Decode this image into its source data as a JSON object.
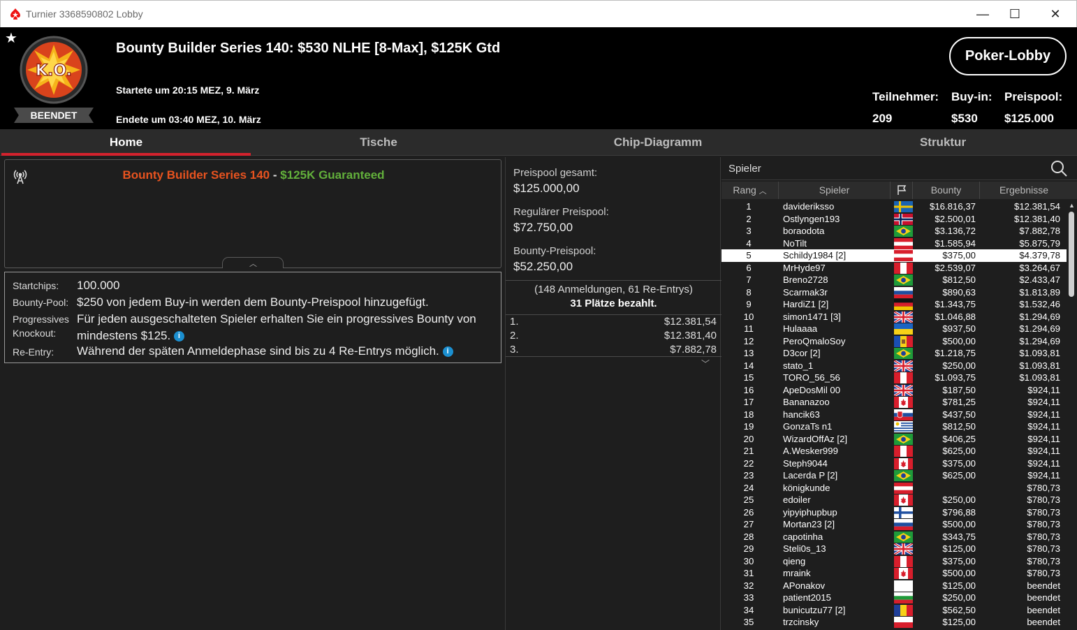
{
  "window": {
    "title": "Turnier 3368590802 Lobby",
    "minimize": "—",
    "maximize": "☐",
    "close": "✕"
  },
  "header": {
    "title": "Bounty Builder Series 140: $530 NLHE [8-Max], $125K Gtd",
    "started": "Startete um 20:15 MEZ, 9. März",
    "ended": "Endete um 03:40 MEZ, 10. März",
    "status_badge": "BEENDET",
    "logo_text": "K.O.",
    "lobby_button": "Poker-Lobby",
    "stats": [
      {
        "label": "Teilnehmer:",
        "value": "209"
      },
      {
        "label": "Buy-in:",
        "value": "$530"
      },
      {
        "label": "Preispool:",
        "value": "$125.000"
      }
    ]
  },
  "tabs": [
    {
      "label": "Home",
      "active": true
    },
    {
      "label": "Tische",
      "active": false
    },
    {
      "label": "Chip-Diagramm",
      "active": false
    },
    {
      "label": "Struktur",
      "active": false
    }
  ],
  "info": {
    "title_orange": "Bounty Builder Series 140",
    "title_sep": " - ",
    "title_green": "$125K Guaranteed"
  },
  "details": {
    "startchips_label": "Startchips:",
    "startchips_value": "100.000",
    "bountypool_label": "Bounty-Pool:",
    "bountypool_value": "$250 von jedem Buy-in werden dem Bounty-Preispool hinzugefügt.",
    "progressive_label_1": "Progressives",
    "progressive_label_2": "Knockout:",
    "progressive_value_1": "Für jeden ausgeschalteten Spieler erhalten Sie ein progressives Bounty von",
    "progressive_value_2": "mindestens $125.",
    "reentry_label": "Re-Entry:",
    "reentry_value": "Während der späten Anmeldephase sind bis zu 4 Re-Entrys möglich."
  },
  "prize": {
    "total_label": "Preispool gesamt:",
    "total_value": "$125.000,00",
    "regular_label": "Regulärer Preispool:",
    "regular_value": "$72.750,00",
    "bounty_label": "Bounty-Preispool:",
    "bounty_value": "$52.250,00",
    "entries_note": "(148 Anmeldungen, 61 Re-Entrys)",
    "paid_note": "31 Plätze bezahlt.",
    "payouts": [
      {
        "place": "1.",
        "amount": "$12.381,54"
      },
      {
        "place": "2.",
        "amount": "$12.381,40"
      },
      {
        "place": "3.",
        "amount": "$7.882,78"
      }
    ]
  },
  "players": {
    "search_label": "Spieler",
    "columns": {
      "rank": "Rang",
      "player": "Spieler",
      "bounty": "Bounty",
      "result": "Ergebnisse"
    },
    "rows": [
      {
        "rank": "1",
        "name": "davideriksso",
        "flag": "se",
        "bounty": "$16.816,37",
        "result": "$12.381,54"
      },
      {
        "rank": "2",
        "name": "Ostlyngen193",
        "flag": "no",
        "bounty": "$2.500,01",
        "result": "$12.381,40"
      },
      {
        "rank": "3",
        "name": "boraodota",
        "flag": "br",
        "bounty": "$3.136,72",
        "result": "$7.882,78"
      },
      {
        "rank": "4",
        "name": "NoTilt",
        "flag": "at",
        "bounty": "$1.585,94",
        "result": "$5.875,79"
      },
      {
        "rank": "5",
        "name": "Schildy1984 [2]",
        "flag": "at",
        "bounty": "$375,00",
        "result": "$4.379,78",
        "selected": true
      },
      {
        "rank": "6",
        "name": "MrHyde97",
        "flag": "pe",
        "bounty": "$2.539,07",
        "result": "$3.264,67"
      },
      {
        "rank": "7",
        "name": "Breno2728",
        "flag": "br",
        "bounty": "$812,50",
        "result": "$2.433,47"
      },
      {
        "rank": "8",
        "name": "Scarmak3r",
        "flag": "si",
        "bounty": "$890,63",
        "result": "$1.813,89"
      },
      {
        "rank": "9",
        "name": "HardiZ1 [2]",
        "flag": "de",
        "bounty": "$1.343,75",
        "result": "$1.532,46"
      },
      {
        "rank": "10",
        "name": "simon1471 [3]",
        "flag": "gb",
        "bounty": "$1.046,88",
        "result": "$1.294,69"
      },
      {
        "rank": "11",
        "name": "Hulaaaa",
        "flag": "ua",
        "bounty": "$937,50",
        "result": "$1.294,69"
      },
      {
        "rank": "12",
        "name": "PeroQmaloSoy",
        "flag": "md",
        "bounty": "$500,00",
        "result": "$1.294,69"
      },
      {
        "rank": "13",
        "name": "D3cor [2]",
        "flag": "br",
        "bounty": "$1.218,75",
        "result": "$1.093,81"
      },
      {
        "rank": "14",
        "name": "stato_1",
        "flag": "gb",
        "bounty": "$250,00",
        "result": "$1.093,81"
      },
      {
        "rank": "15",
        "name": "TORO_56_56",
        "flag": "pe",
        "bounty": "$1.093,75",
        "result": "$1.093,81"
      },
      {
        "rank": "16",
        "name": "ApeDosMil 00",
        "flag": "gb",
        "bounty": "$187,50",
        "result": "$924,11"
      },
      {
        "rank": "17",
        "name": "Bananazoo",
        "flag": "ca",
        "bounty": "$781,25",
        "result": "$924,11"
      },
      {
        "rank": "18",
        "name": "hancik63",
        "flag": "sk",
        "bounty": "$437,50",
        "result": "$924,11"
      },
      {
        "rank": "19",
        "name": "GonzaTs n1",
        "flag": "uy",
        "bounty": "$812,50",
        "result": "$924,11"
      },
      {
        "rank": "20",
        "name": "WizardOffAz [2]",
        "flag": "br",
        "bounty": "$406,25",
        "result": "$924,11"
      },
      {
        "rank": "21",
        "name": "A.Wesker999",
        "flag": "pe",
        "bounty": "$625,00",
        "result": "$924,11"
      },
      {
        "rank": "22",
        "name": "Steph9044",
        "flag": "ca",
        "bounty": "$375,00",
        "result": "$924,11"
      },
      {
        "rank": "23",
        "name": "Lacerda P [2]",
        "flag": "br",
        "bounty": "$625,00",
        "result": "$924,11"
      },
      {
        "rank": "24",
        "name": "königkunde",
        "flag": "at",
        "bounty": "",
        "result": "$780,73"
      },
      {
        "rank": "25",
        "name": "edoiler",
        "flag": "ca",
        "bounty": "$250,00",
        "result": "$780,73"
      },
      {
        "rank": "26",
        "name": "yipyiphupbup",
        "flag": "fi",
        "bounty": "$796,88",
        "result": "$780,73"
      },
      {
        "rank": "27",
        "name": "Mortan23 [2]",
        "flag": "ru",
        "bounty": "$500,00",
        "result": "$780,73"
      },
      {
        "rank": "28",
        "name": "capotinha",
        "flag": "br",
        "bounty": "$343,75",
        "result": "$780,73"
      },
      {
        "rank": "29",
        "name": "Steli0s_13",
        "flag": "gb",
        "bounty": "$125,00",
        "result": "$780,73"
      },
      {
        "rank": "30",
        "name": "qieng",
        "flag": "pe",
        "bounty": "$375,00",
        "result": "$780,73"
      },
      {
        "rank": "31",
        "name": "mraink",
        "flag": "ca",
        "bounty": "$500,00",
        "result": "$780,73"
      },
      {
        "rank": "32",
        "name": "APonakov",
        "flag": "wh",
        "bounty": "$125,00",
        "result": "beendet"
      },
      {
        "rank": "33",
        "name": "patient2015",
        "flag": "bg",
        "bounty": "$250,00",
        "result": "beendet"
      },
      {
        "rank": "34",
        "name": "bunicutzu77 [2]",
        "flag": "ro",
        "bounty": "$562,50",
        "result": "beendet"
      },
      {
        "rank": "35",
        "name": "trzcinsky",
        "flag": "pl",
        "bounty": "$125,00",
        "result": "beendet"
      }
    ]
  },
  "colors": {
    "accent_red": "#d3222d",
    "title_orange": "#e8531f",
    "title_green": "#62b03b",
    "info_blue": "#1b8fd0"
  }
}
